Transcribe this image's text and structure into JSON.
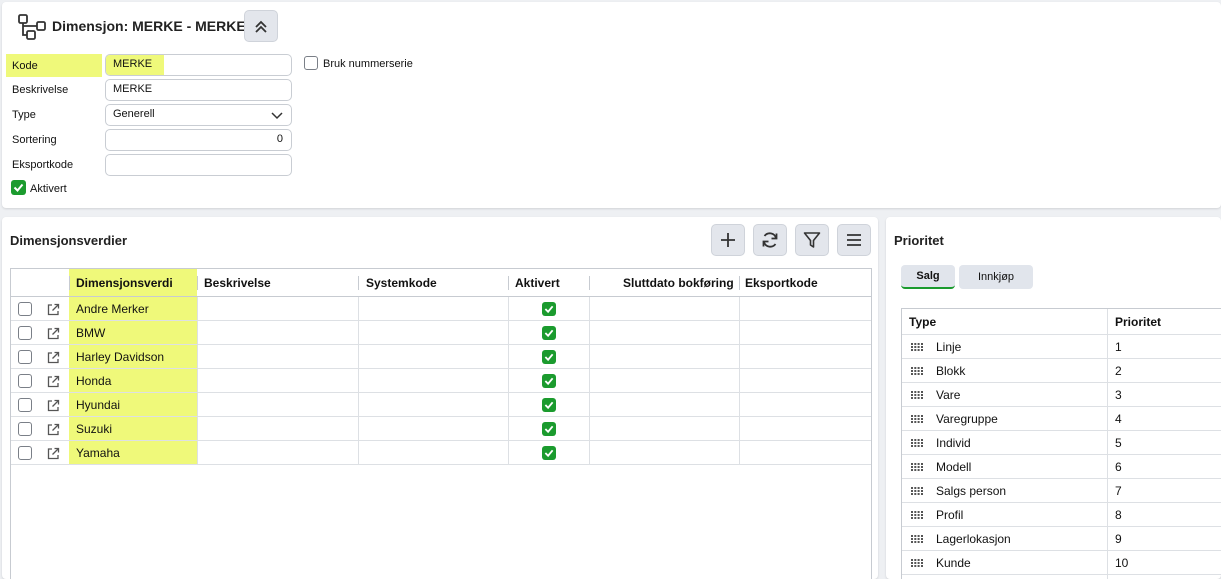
{
  "header": {
    "title": "Dimensjon: MERKE - MERKE",
    "icon": "hierarchy-icon",
    "collapse_icon": "chevron-double-up-icon"
  },
  "form": {
    "kode_label": "Kode",
    "kode_value": "MERKE",
    "beskrivelse_label": "Beskrivelse",
    "beskrivelse_value": "MERKE",
    "type_label": "Type",
    "type_value": "Generell",
    "sortering_label": "Sortering",
    "sortering_value": "0",
    "eksportkode_label": "Eksportkode",
    "eksportkode_value": "",
    "aktivert_label": "Aktivert",
    "aktivert_checked": true,
    "bruk_nummerserie_label": "Bruk nummerserie",
    "bruk_nummerserie_checked": false
  },
  "dimvalues": {
    "title": "Dimensjonsverdier",
    "toolbar": [
      "plus-icon",
      "refresh-icon",
      "filter-icon",
      "menu-icon"
    ],
    "columns": {
      "dimverdi": "Dimensjonsverdi",
      "beskrivelse": "Beskrivelse",
      "systemkode": "Systemkode",
      "aktivert": "Aktivert",
      "sluttdato": "Sluttdato bokføring",
      "eksportkode": "Eksportkode"
    },
    "rows": [
      {
        "name": "Andre Merker",
        "aktivert": true
      },
      {
        "name": "BMW",
        "aktivert": true
      },
      {
        "name": "Harley Davidson",
        "aktivert": true
      },
      {
        "name": "Honda",
        "aktivert": true
      },
      {
        "name": "Hyundai",
        "aktivert": true
      },
      {
        "name": "Suzuki",
        "aktivert": true
      },
      {
        "name": "Yamaha",
        "aktivert": true
      }
    ]
  },
  "priority": {
    "title": "Prioritet",
    "tabs": [
      "Salg",
      "Innkjøp"
    ],
    "active_tab": "Salg",
    "columns": {
      "type": "Type",
      "prioritet": "Prioritet"
    },
    "rows": [
      {
        "type": "Linje",
        "prio": "1"
      },
      {
        "type": "Blokk",
        "prio": "2"
      },
      {
        "type": "Vare",
        "prio": "3"
      },
      {
        "type": "Varegruppe",
        "prio": "4"
      },
      {
        "type": "Individ",
        "prio": "5"
      },
      {
        "type": "Modell",
        "prio": "6"
      },
      {
        "type": "Salgs person",
        "prio": "7"
      },
      {
        "type": "Profil",
        "prio": "8"
      },
      {
        "type": "Lagerlokasjon",
        "prio": "9"
      },
      {
        "type": "Kunde",
        "prio": "10"
      }
    ]
  },
  "colors": {
    "highlight": "#eff97a",
    "check_green": "#1b9b2e",
    "tab_underline": "#1b9b2e"
  }
}
